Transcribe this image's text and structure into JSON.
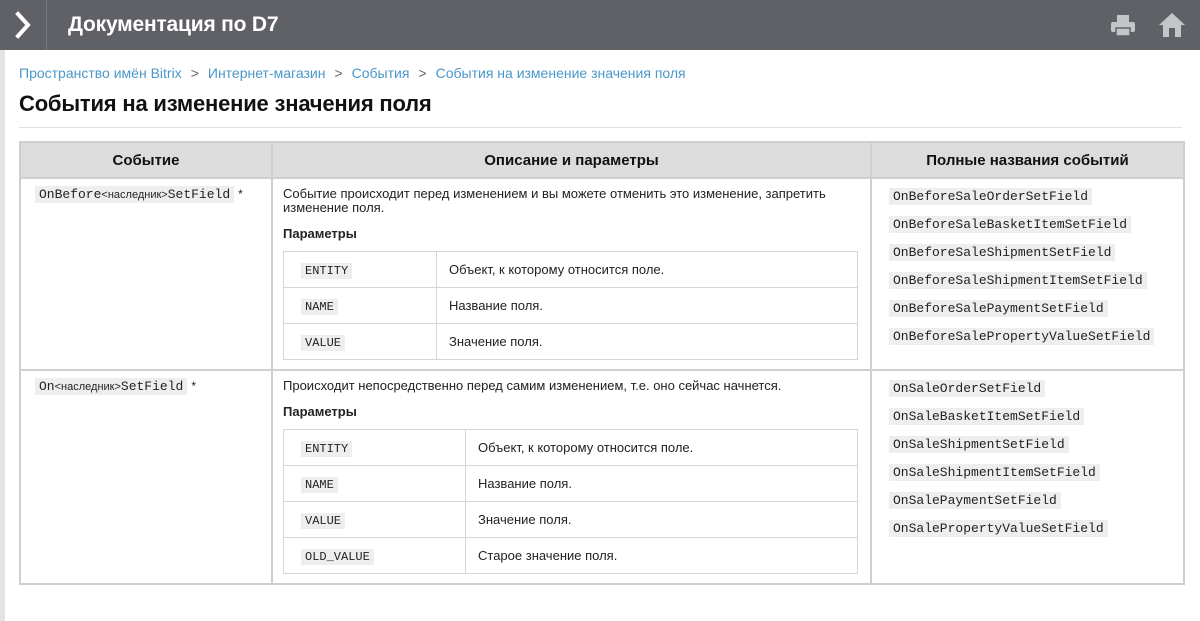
{
  "header": {
    "title": "Документация по D7",
    "icons": [
      "chevron-right-icon",
      "print-icon",
      "home-icon"
    ]
  },
  "breadcrumb": [
    {
      "label": "Пространство имён Bitrix"
    },
    {
      "label": "Интернет-магазин"
    },
    {
      "label": "События"
    },
    {
      "label": "События на изменение значения поля"
    }
  ],
  "breadcrumb_separator": ">",
  "page_title": "События на изменение значения поля",
  "table": {
    "headers": [
      "Событие",
      "Описание и параметры",
      "Полные названия событий"
    ],
    "params_heading": "Параметры",
    "rows": [
      {
        "event_prefix": "OnBefore",
        "event_inner": "<наследник>",
        "event_suffix": "SetField",
        "event_mark": "*",
        "description": "Событие происходит перед изменением и вы можете отменить это изменение, запретить изменение поля.",
        "params": [
          {
            "name": "ENTITY",
            "desc": "Объект, к которому относится поле."
          },
          {
            "name": "NAME",
            "desc": "Название поля."
          },
          {
            "name": "VALUE",
            "desc": "Значение поля."
          }
        ],
        "full_names": [
          "OnBeforeSaleOrderSetField",
          "OnBeforeSaleBasketItemSetField",
          "OnBeforeSaleShipmentSetField",
          "OnBeforeSaleShipmentItemSetField",
          "OnBeforeSalePaymentSetField",
          "OnBeforeSalePropertyValueSetField"
        ]
      },
      {
        "event_prefix": "On",
        "event_inner": "<наследник>",
        "event_suffix": "SetField",
        "event_mark": "*",
        "description": "Происходит непосредственно перед самим изменением, т.е. оно сейчас начнется.",
        "params": [
          {
            "name": "ENTITY",
            "desc": "Объект, к которому относится поле."
          },
          {
            "name": "NAME",
            "desc": "Название поля."
          },
          {
            "name": "VALUE",
            "desc": "Значение поля."
          },
          {
            "name": "OLD_VALUE",
            "desc": "Старое значение поля."
          }
        ],
        "full_names": [
          "OnSaleOrderSetField",
          "OnSaleBasketItemSetField",
          "OnSaleShipmentSetField",
          "OnSaleShipmentItemSetField",
          "OnSalePaymentSetField",
          "OnSalePropertyValueSetField"
        ]
      }
    ]
  },
  "colors": {
    "header_bg": "#5f6166",
    "link": "#4a97c9",
    "table_header_bg": "#dcdcdc",
    "code_bg": "#eeeeee"
  }
}
